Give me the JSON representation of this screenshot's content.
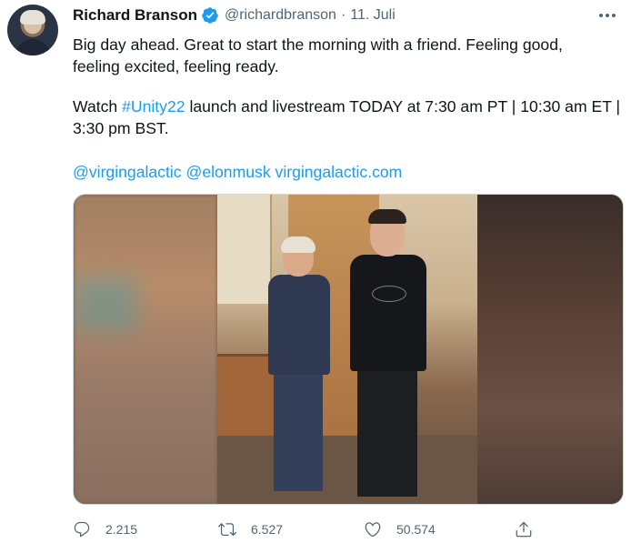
{
  "author": {
    "name": "Richard Branson",
    "handle": "@richardbranson",
    "separator": "·",
    "date": "11. Juli",
    "verified": true
  },
  "tweet": {
    "line1": "Big day ahead. Great to start the morning with a friend. Feeling good,",
    "line2": "feeling excited, feeling ready.",
    "watch_prefix": "Watch ",
    "hashtag": "#Unity22",
    "watch_suffix": " launch and livestream TODAY at 7:30 am PT | 10:30 am ET |",
    "line4": "3:30 pm BST.",
    "mention1": "@virgingalactic",
    "mention2": "@elonmusk",
    "url": "virgingalactic.com"
  },
  "actions": {
    "replies": "2.215",
    "retweets": "6.527",
    "likes": "50.574"
  },
  "icons": {
    "more": "more-dots-icon",
    "reply": "reply-icon",
    "retweet": "retweet-icon",
    "like": "heart-icon",
    "share": "share-icon",
    "verified": "verified-badge-icon"
  },
  "colors": {
    "link": "#1d9bf0",
    "verified": "#1d9bf0",
    "secondary_text": "#536471"
  }
}
